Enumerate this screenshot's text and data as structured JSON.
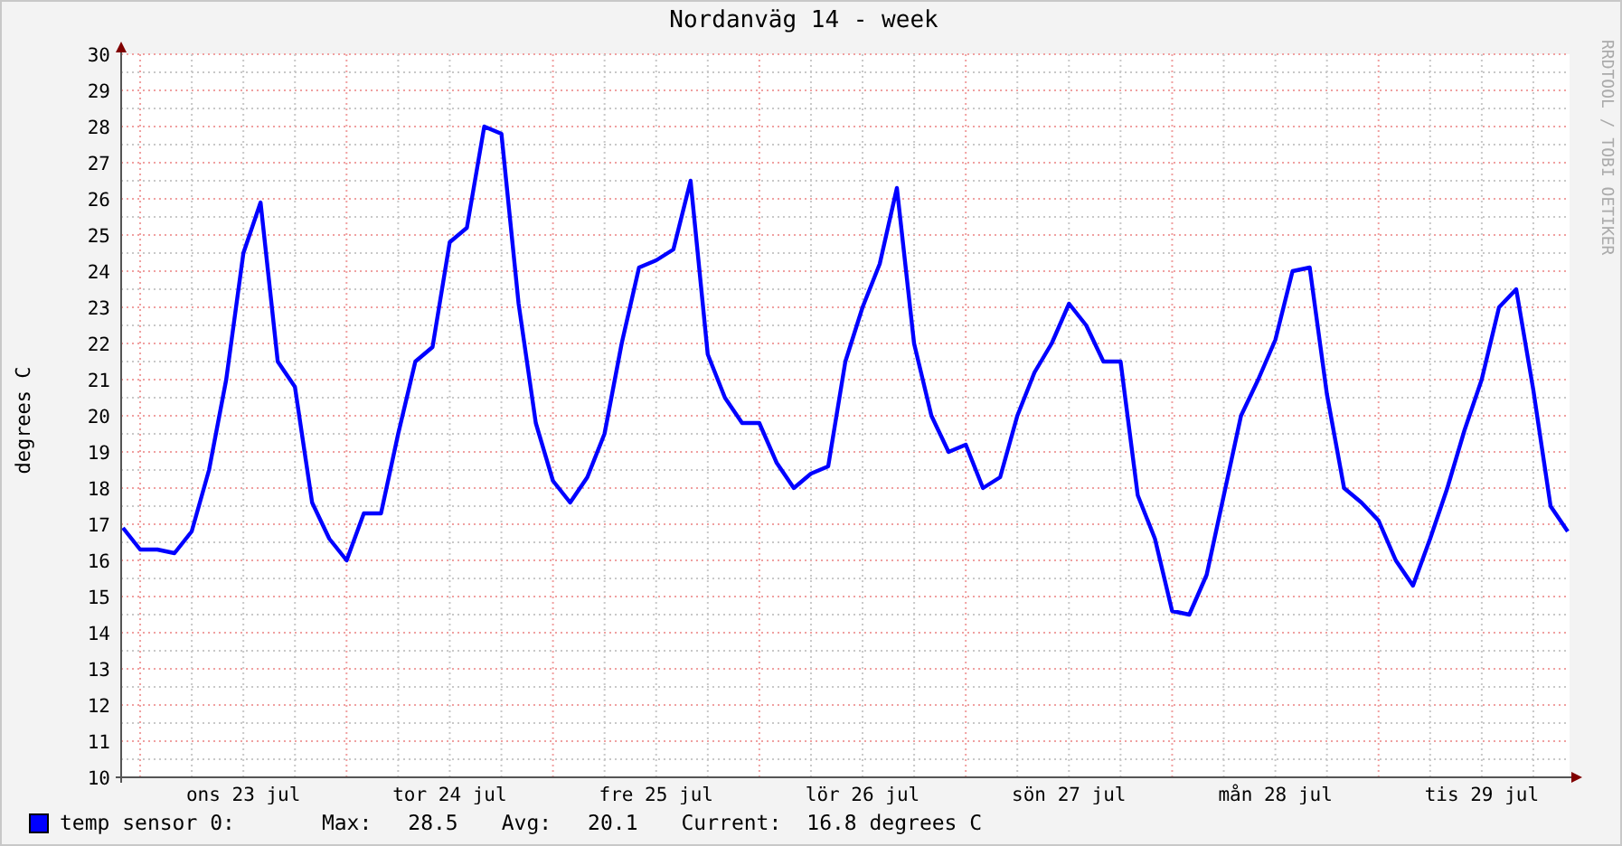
{
  "chart_data": {
    "type": "line",
    "grid": true,
    "title": "Nordanväg 14 - week",
    "ylabel": "degrees C",
    "ylim": [
      10,
      30
    ],
    "yticks": [
      10,
      11,
      12,
      13,
      14,
      15,
      16,
      17,
      18,
      19,
      20,
      21,
      22,
      23,
      24,
      25,
      26,
      27,
      28,
      29,
      30
    ],
    "categories": [
      null,
      null,
      null,
      null,
      null,
      null,
      null,
      "ons 23 jul",
      null,
      null,
      null,
      null,
      null,
      null,
      null,
      null,
      null,
      null,
      null,
      "tor 24 jul",
      null,
      null,
      null,
      null,
      null,
      null,
      null,
      null,
      null,
      null,
      null,
      "fre 25 jul",
      null,
      null,
      null,
      null,
      null,
      null,
      null,
      null,
      null,
      null,
      null,
      "lör 26 jul",
      null,
      null,
      null,
      null,
      null,
      null,
      null,
      null,
      null,
      null,
      null,
      "sön 27 jul",
      null,
      null,
      null,
      null,
      null,
      null,
      null,
      null,
      null,
      null,
      null,
      "mån 28 jul",
      null,
      null,
      null,
      null,
      null,
      null,
      null,
      null,
      null,
      null,
      null,
      "tis 29 jul",
      null,
      null,
      null,
      null,
      null
    ],
    "series": [
      {
        "name": "temp sensor 0:",
        "color": "#0000ff",
        "values": [
          16.9,
          16.3,
          16.3,
          16.2,
          16.8,
          18.5,
          21.0,
          24.5,
          25.9,
          21.5,
          20.8,
          17.6,
          16.6,
          16.0,
          17.3,
          17.3,
          19.5,
          21.5,
          21.9,
          24.8,
          25.2,
          28.0,
          27.8,
          23.1,
          19.8,
          18.2,
          17.6,
          18.3,
          19.5,
          22.0,
          24.1,
          24.3,
          24.6,
          26.5,
          21.7,
          20.5,
          19.8,
          19.8,
          18.7,
          18.0,
          18.4,
          18.6,
          21.5,
          23.0,
          24.2,
          26.3,
          22.0,
          20.0,
          19.0,
          19.2,
          18.0,
          18.3,
          20.0,
          21.2,
          22.0,
          23.1,
          22.5,
          21.5,
          21.5,
          17.8,
          16.6,
          14.6,
          14.5,
          15.6,
          17.8,
          20.0,
          21.0,
          22.1,
          24.0,
          24.1,
          20.6,
          18.0,
          17.6,
          17.1,
          16.0,
          15.3,
          16.6,
          18.0,
          19.6,
          21.0,
          23.0,
          23.5,
          20.7,
          17.5,
          16.8
        ]
      }
    ]
  },
  "legend": {
    "max_label": "Max:",
    "max": "28.5",
    "avg_label": "Avg:",
    "avg": "20.1",
    "current_label": "Current:",
    "current": "16.8 degrees C"
  },
  "signature": "RRDTOOL / TOBI OETIKER"
}
